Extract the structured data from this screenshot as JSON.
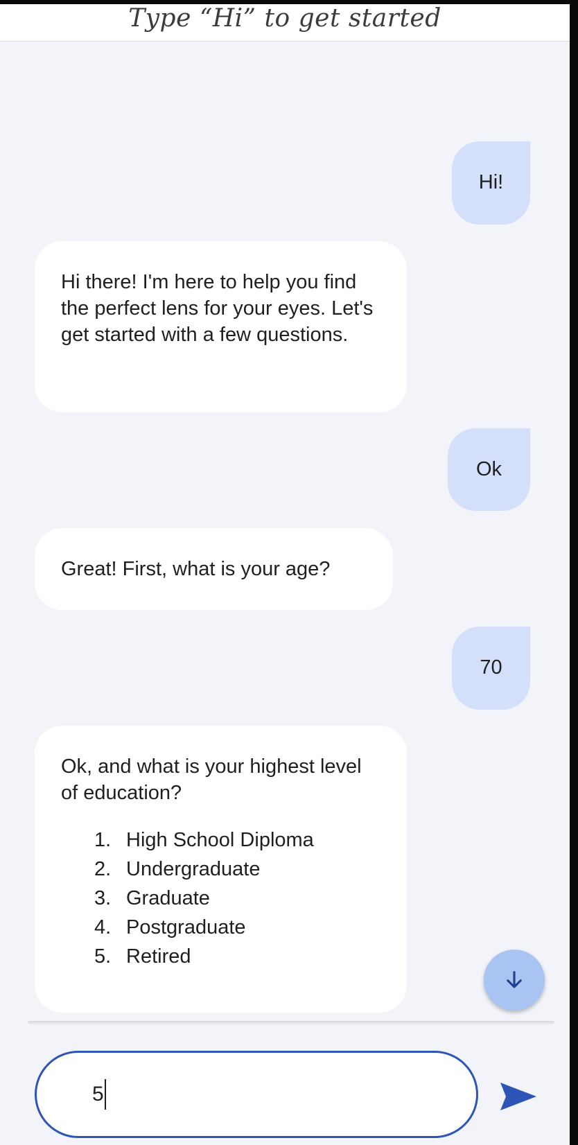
{
  "header": {
    "title": "Type “Hi” to get started"
  },
  "messages": {
    "user_1": "Hi!",
    "bot_1": "Hi there! I'm here to help you find the perfect lens for your eyes. Let's get started with a few questions.",
    "user_2": "Ok",
    "bot_2": "Great! First, what is your age?",
    "user_3": "70",
    "bot_3": {
      "text": "Ok, and what is your highest level of education?",
      "options": [
        {
          "num": "1.",
          "label": "High School Diploma"
        },
        {
          "num": "2.",
          "label": "Undergraduate"
        },
        {
          "num": "3.",
          "label": "Graduate"
        },
        {
          "num": "4.",
          "label": "Postgraduate"
        },
        {
          "num": "5.",
          "label": "Retired"
        }
      ]
    }
  },
  "composer": {
    "value": "5"
  },
  "icons": {
    "scroll": "arrow-down-icon",
    "send": "send-icon"
  },
  "colors": {
    "accent": "#2c55b5",
    "user_bubble": "#d4e0fa",
    "scroll_button": "#a9c3f2"
  }
}
